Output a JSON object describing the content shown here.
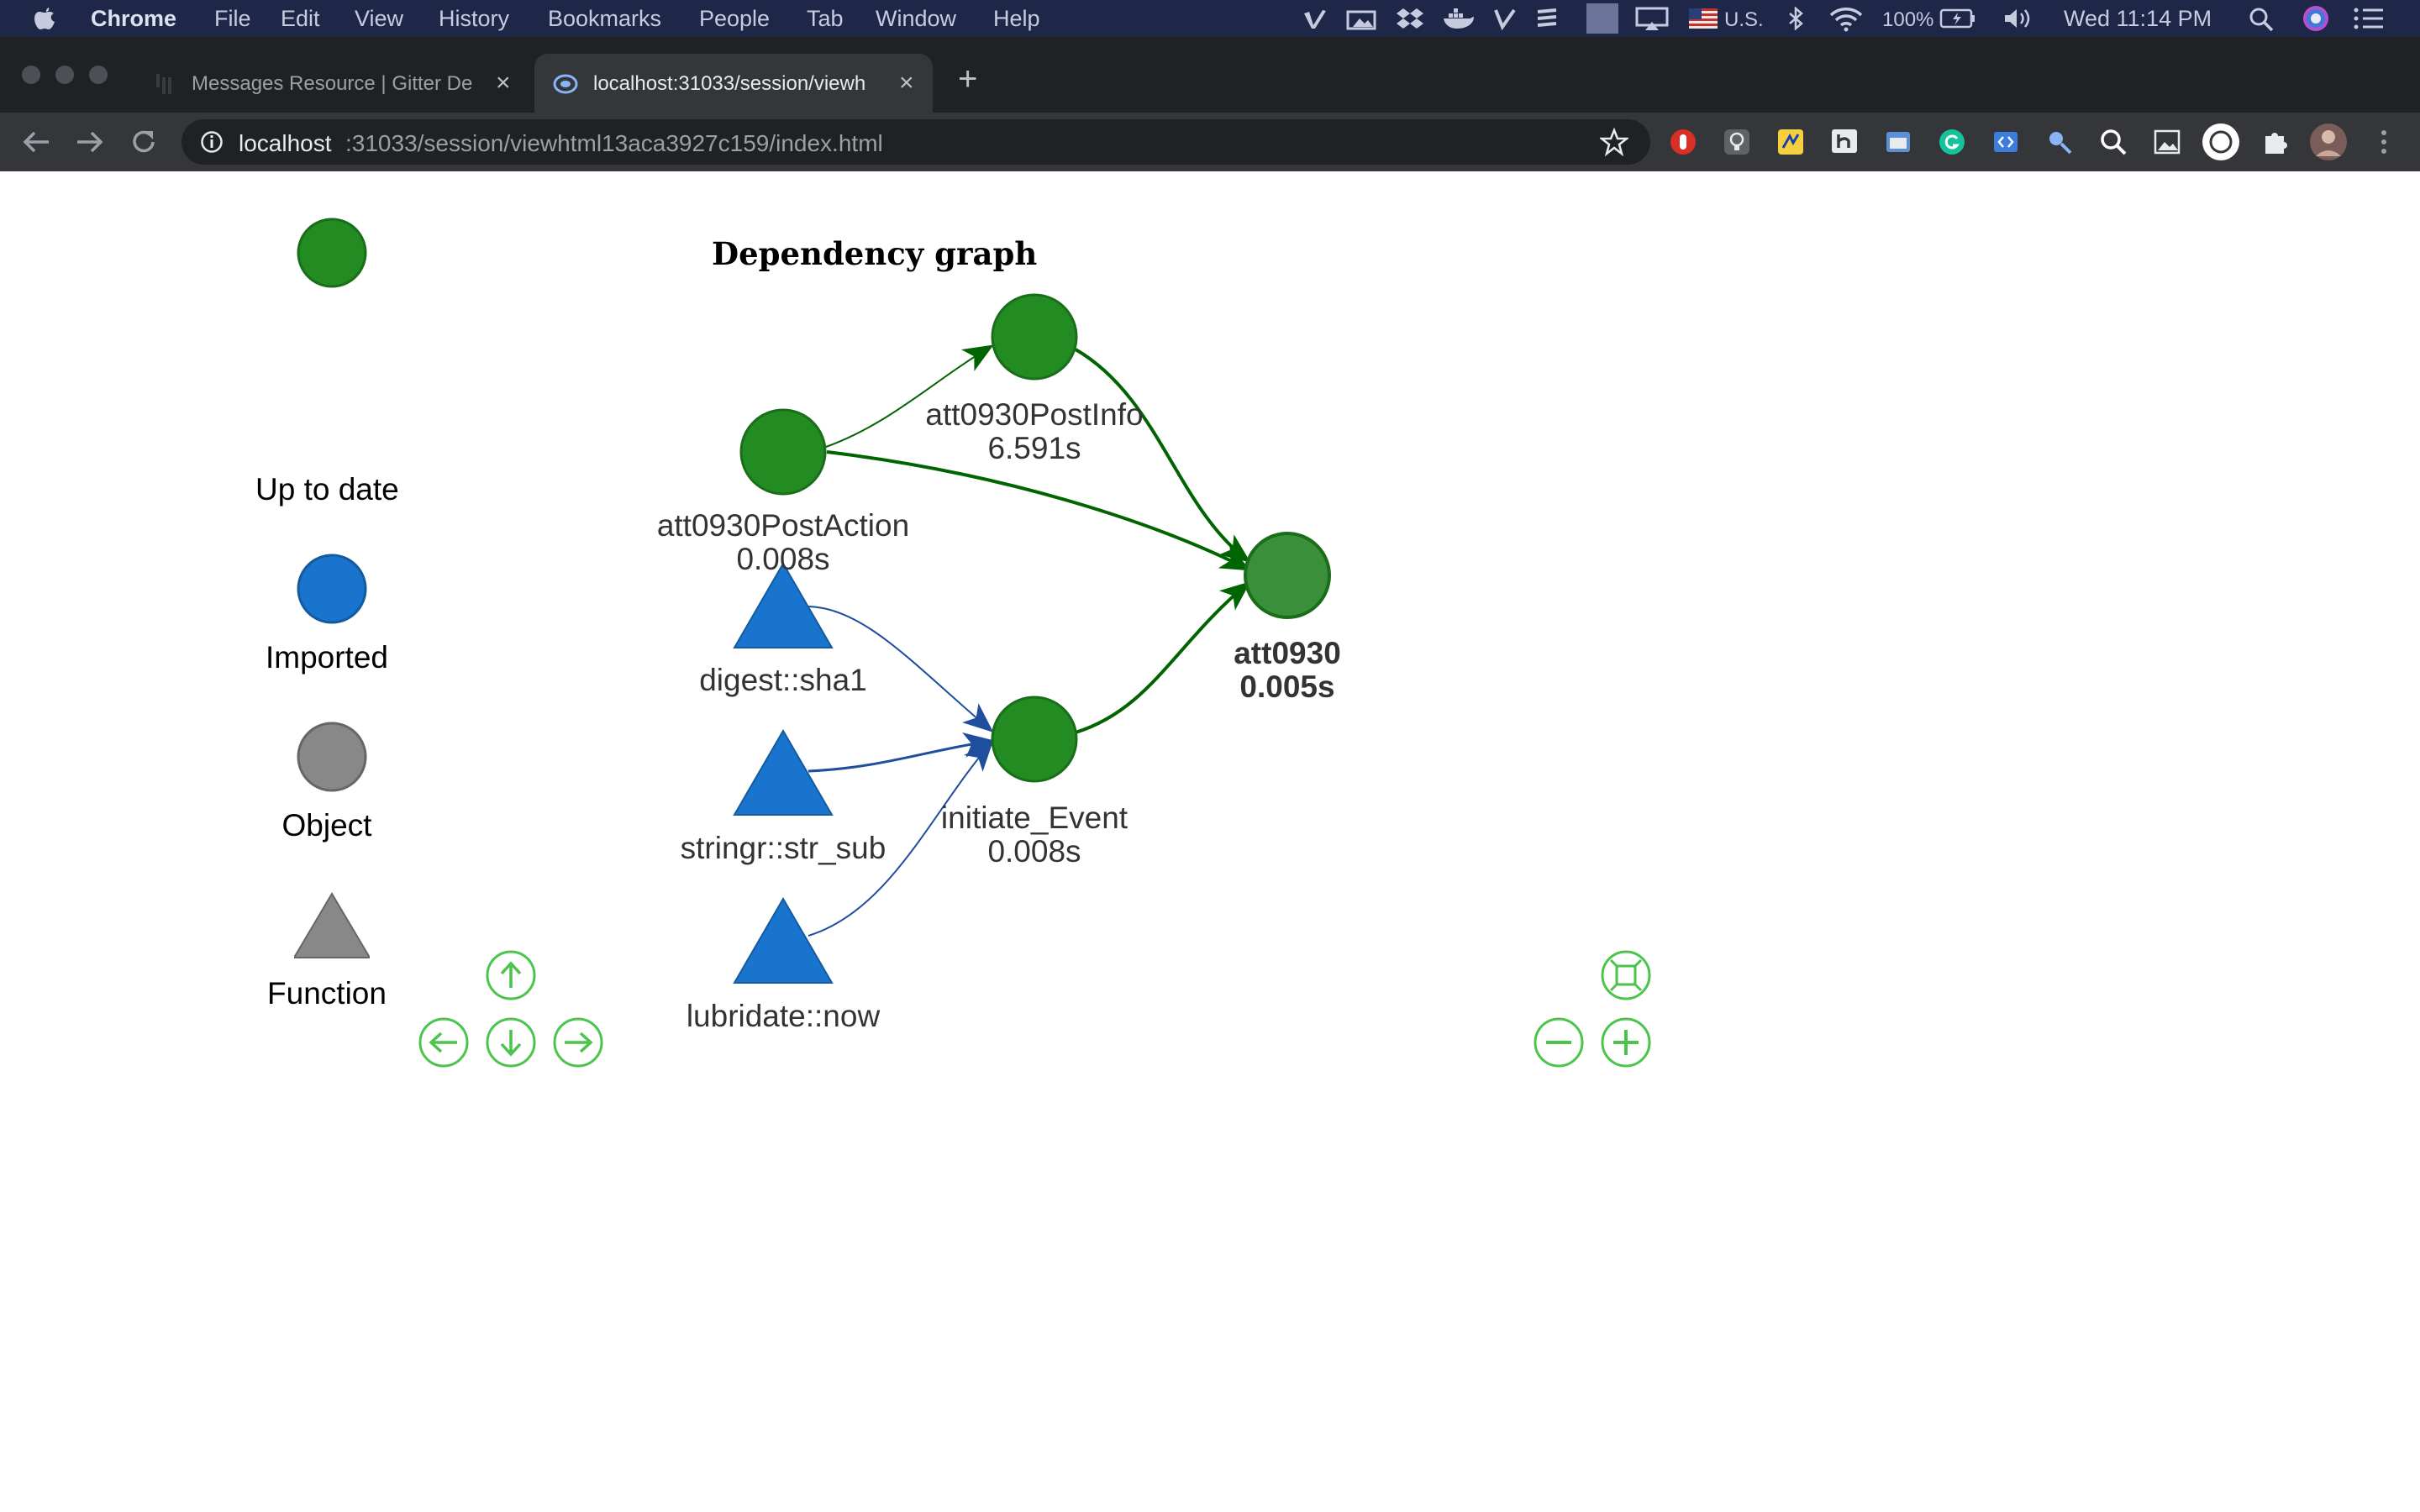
{
  "menubar": {
    "app": "Chrome",
    "items": [
      "File",
      "Edit",
      "View",
      "History",
      "Bookmarks",
      "People",
      "Tab",
      "Window",
      "Help"
    ],
    "input_source": "U.S.",
    "battery": "100%",
    "clock": "Wed 11:14 PM"
  },
  "tabs": [
    {
      "title": "Messages Resource | Gitter De",
      "active": false
    },
    {
      "title": "localhost:31033/session/viewh",
      "active": true
    }
  ],
  "address": {
    "host": "localhost",
    "path": ":31033/session/viewhtml13aca3927c159/index.html"
  },
  "graph": {
    "title": "Dependency graph",
    "colors": {
      "up_to_date": "#228b22",
      "imported": "#1874cd",
      "object": "#888888",
      "target_final": "#3a8f3a",
      "edge_green": "#006400",
      "edge_blue": "#1f4e9e",
      "nav": "#4cc44c"
    },
    "legend": [
      {
        "label": "Up to date",
        "shape": "circle",
        "color": "#228b22"
      },
      {
        "label": "Imported",
        "shape": "circle",
        "color": "#1874cd"
      },
      {
        "label": "Object",
        "shape": "circle",
        "color": "#888888"
      },
      {
        "label": "Function",
        "shape": "triangle",
        "color": "#888888"
      }
    ],
    "nodes": [
      {
        "id": "att0930PostAction",
        "name": "att0930PostAction",
        "time": "0.008s",
        "shape": "circle",
        "status": "up_to_date"
      },
      {
        "id": "att0930PostInfo",
        "name": "att0930PostInfo",
        "time": "6.591s",
        "shape": "circle",
        "status": "up_to_date"
      },
      {
        "id": "att0930",
        "name": "att0930",
        "time": "0.005s",
        "shape": "circle",
        "status": "up_to_date",
        "selected": true
      },
      {
        "id": "initiate_Event",
        "name": "initiate_Event",
        "time": "0.008s",
        "shape": "circle",
        "status": "up_to_date"
      },
      {
        "id": "digest::sha1",
        "name": "digest::sha1",
        "shape": "triangle",
        "status": "imported"
      },
      {
        "id": "stringr::str_sub",
        "name": "stringr::str_sub",
        "shape": "triangle",
        "status": "imported"
      },
      {
        "id": "lubridate::now",
        "name": "lubridate::now",
        "shape": "triangle",
        "status": "imported"
      }
    ],
    "edges": [
      {
        "from": "att0930PostAction",
        "to": "att0930PostInfo"
      },
      {
        "from": "att0930PostAction",
        "to": "att0930"
      },
      {
        "from": "att0930PostInfo",
        "to": "att0930"
      },
      {
        "from": "initiate_Event",
        "to": "att0930"
      },
      {
        "from": "digest::sha1",
        "to": "initiate_Event"
      },
      {
        "from": "stringr::str_sub",
        "to": "initiate_Event"
      },
      {
        "from": "lubridate::now",
        "to": "initiate_Event"
      }
    ]
  }
}
